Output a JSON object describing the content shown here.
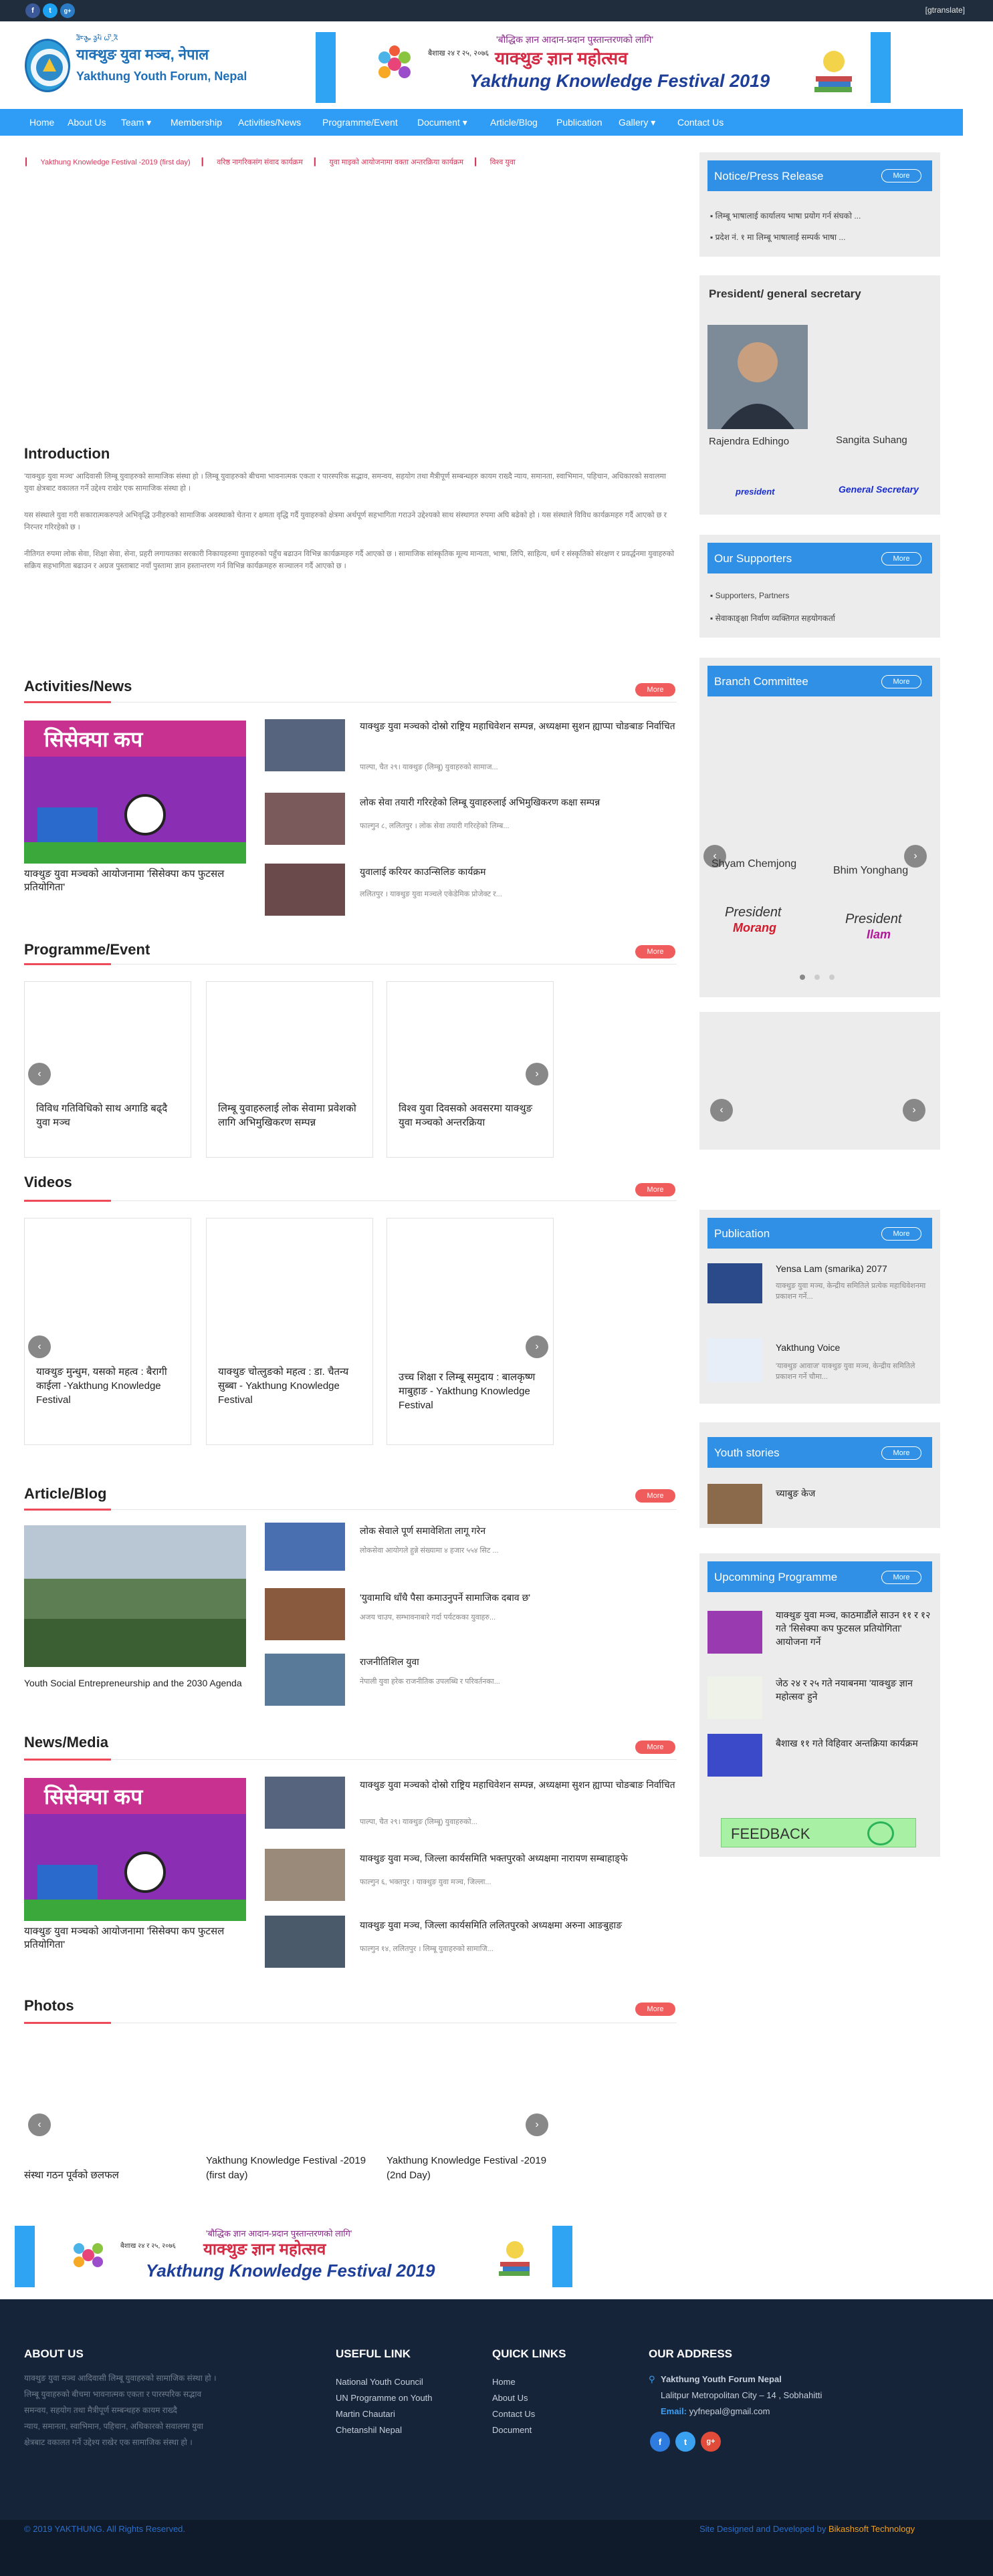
{
  "topbar": {
    "translate": "[gtranslate]",
    "social": [
      "f",
      "t",
      "g+"
    ]
  },
  "brand": {
    "nepali_name": "याक्थुङ युवा मञ्च, नेपाल",
    "english_name": "Yakthung Youth Forum, Nepal",
    "lipi_line": "ᤕᤠᤰᤌᤢᤱ ᤕᤢᤘᤠ ᤐᤡᤳᤖᤠ"
  },
  "banner": {
    "slogan": "'बौद्धिक ज्ञान आदान-प्रदान पुस्तान्तरणको लागि'",
    "festival_np": "याक्थुङ ज्ञान महोत्सव",
    "festival_en": "Yakthung Knowledge Festival 2019",
    "date": "बैशाख २४ र २५, २०७६"
  },
  "nav": {
    "items": [
      "Home",
      "About Us",
      "Team ▾",
      "Membership",
      "Activities/News",
      "Programme/Event",
      "Document ▾",
      "Article/Blog",
      "Publication",
      "Gallery ▾",
      "Contact Us"
    ]
  },
  "ticker": {
    "items": [
      "Yakthung Knowledge Festival -2019 (first day)",
      "वरिष्ठ नागरिकसंग संवाद कार्यक्रम",
      "युवा माइको आयोजनामा वक्ता अन्तरक्रिया कार्यक्रम",
      "विश्व युवा"
    ]
  },
  "intro": {
    "title": "Introduction",
    "paras": [
      "'याक्थुङ युवा मञ्च' आदिवासी लिम्बू युवाहरुको सामाजिक संस्था हो । लिम्बू युवाहरुको बीचमा भावनात्मक एकता र पारस्परिक सद्भाव, समन्वय, सहयोग तथा मैत्रीपूर्ण सम्बन्धहरु कायम राख्दै न्याय, समानता, स्वाभिमान, पहिचान, अधिकारको सवालमा युवा क्षेत्रबाट वकालत गर्ने उद्देश्य राखेर एक सामाजिक संस्था हो ।",
      "यस संस्थाले युवा गरी सकारात्मकरुपले अभिवृद्धि उनीहरुको सामाजिक अवस्थाको चेतना र क्षमता वृद्धि गर्दै युवाहरुको क्षेत्रमा अर्थपूर्ण सहभागिता गराउने उद्देश्यको साथ संस्थागत रुपमा अघि बढेको हो । यस संस्थाले विविध कार्यक्रमहरु गर्दै आएको छ र निरन्तर गरिरहेको छ ।",
      "नीतिगत रुपमा लोक सेवा, शिक्षा सेवा, सेना, प्रहरी लगायतका सरकारी निकायहरुमा युवाहरुको पहुँच बढाउन विभिन्न कार्यक्रमहरु गर्दै आएको छ । सामाजिक सांस्कृतिक मूल्य मान्यता, भाषा, लिपि, साहित्य, धर्म र संस्कृतिको संरक्षण र प्रवर्द्धनमा युवाहरुको सक्रिय सहभागिता बढाउन र अग्रज पुस्ताबाट नयाँ पुस्तामा ज्ञान हस्तान्तरण गर्न विभिन्न कार्यक्रमहरु सञ्चालन गर्दै आएको छ ।"
    ]
  },
  "activities": {
    "title": "Activities/News",
    "more": "More",
    "featured_img_title": "सिसेक्पा कप",
    "featured_caption": "याक्थुङ युवा मञ्चको आयोजनामा 'सिसेक्पा कप फुटसल प्रतियोगिता'",
    "items": [
      {
        "title": "याक्थुङ युवा मञ्चको दोस्रो राष्ट्रिय महाधिवेशन सम्पन्न, अध्यक्षमा सुशन ह्याप्पा चोङबाङ निर्वाचित",
        "meta": "पाल्पा, चैत २९। याक्थुङ (लिम्बू) युवाहरुको सामाज..."
      },
      {
        "title": "लोक सेवा तयारी गरिरहेको लिम्बू युवाहरुलाई अभिमुखिकरण कक्षा सम्पन्न",
        "meta": "फाल्गुन ८, ललितपुर । लोक सेवा तयारी गरिरहेको लिम्ब..."
      },
      {
        "title": "युवालाई करियर काउन्सिलिङ कार्यक्रम",
        "meta": "ललितपुर । याक्थुङ युवा मञ्चले एकेडेमिक प्रोजेक्ट र..."
      }
    ]
  },
  "programme": {
    "title": "Programme/Event",
    "more": "More",
    "items": [
      "विविध गतिविधिको साथ अगाडि बढ्दै युवा मञ्च",
      "लिम्बू युवाहरुलाई लोक सेवामा प्रवेशको लागि अभिमुखिकरण सम्पन्न",
      "विश्व युवा दिवसको अवसरमा याक्थुङ युवा मञ्चको अन्तरक्रिया"
    ]
  },
  "videos": {
    "title": "Videos",
    "more": "More",
    "items": [
      "याक्थुङ मुन्धुम, यसको महत्व : बैरागी काईला -Yakthung Knowledge Festival",
      "याक्थुङ चोत्लुङको महत्व : डा. चैतन्य सुब्बा - Yakthung Knowledge Festival",
      "उच्च शिक्षा र लिम्बू समुदाय : बालकृष्ण माबुहाङ - Yakthung Knowledge Festival"
    ]
  },
  "article": {
    "title": "Article/Blog",
    "more": "More",
    "featured_caption": "Youth Social Entrepreneurship and the 2030 Agenda",
    "items": [
      {
        "title": "लोक सेवाले पूर्ण समावेशिता लागू गरेन",
        "meta": "लोकसेवा आयोगले हुन्ने संख्यामा ४ हजार ५५४ सिट ..."
      },
      {
        "title": "'युवामाथि धाँधै पैसा कमाउनुपर्ने सामाजिक दबाव छ'",
        "meta": "अजय चाउप, सम्भावनाबारे गर्दा पर्यटकका युवाहरु..."
      },
      {
        "title": "राजनीतिशिल युवा",
        "meta": "नेपाली युवा हरेक राजनीतिक उपलब्धि र परिवर्तनका..."
      }
    ]
  },
  "newsmedia": {
    "title": "News/Media",
    "more": "More",
    "featured_img_title": "सिसेक्पा कप",
    "featured_caption": "याक्थुङ युवा मञ्चको आयोजनामा 'सिसेक्पा कप फुटसल प्रतियोगिता'",
    "items": [
      {
        "title": "याक्थुङ युवा मञ्चको दोस्रो राष्ट्रिय महाधिवेशन सम्पन्न, अध्यक्षमा सुशन ह्याप्पा चोङबाङ निर्वाचित",
        "meta": "पाल्पा, चैत २९। याक्थुङ (लिम्बू) युवाहरुको..."
      },
      {
        "title": "याक्थुङ युवा मञ्च, जिल्ला कार्यसमिति भक्तपुरको अध्यक्षमा नारायण सम्बाहाङ्फे",
        "meta": "फाल्गुन ६, भक्तपुर । याक्थुङ युवा मञ्च, जिल्ला..."
      },
      {
        "title": "याक्थुङ युवा मञ्च, जिल्ला कार्यसमिति ललितपुरको अध्यक्षमा अरुना आङबुहाङ",
        "meta": "फाल्गुन १४, ललितपुर । लिम्बू युवाहरुको सामाजि..."
      }
    ]
  },
  "photos": {
    "title": "Photos",
    "more": "More",
    "items": [
      "संस्था गठन पूर्वको छलफल",
      "Yakthung Knowledge Festival -2019 (first day)",
      "Yakthung Knowledge Festival -2019 (2nd Day)"
    ]
  },
  "sidebar": {
    "notice": {
      "title": "Notice/Press Release",
      "more": "More",
      "items": [
        "लिम्बू भाषालाई कार्यालय भाषा प्रयोग गर्न संघको ...",
        "प्रदेश नं. १ मा लिम्बू भाषालाई सम्पर्क भाषा ..."
      ]
    },
    "president": {
      "title": "President/ general secretary",
      "p1_name": "Rajendra Edhingo",
      "p2_name": "Sangita Suhang",
      "p1_role": "president",
      "p2_role": "General Secretary"
    },
    "supporters": {
      "title": "Our Supporters",
      "more": "More",
      "items": [
        "Supporters, Partners",
        "सेवाकाङ्क्षा निर्वाण व्यक्तिगत सहयोगकर्ता"
      ]
    },
    "branch": {
      "title": "Branch Committee",
      "more": "More",
      "b1_name": "Shyam Chemjong",
      "b2_name": "Bhim Yonghang",
      "b1_role": "President",
      "b1_place": "Morang",
      "b2_role": "President",
      "b2_place": "Ilam"
    },
    "publication": {
      "title": "Publication",
      "more": "More",
      "items": [
        {
          "title": "Yensa Lam (smarika) 2077",
          "meta": "याक्थुङ युवा मञ्च, केन्द्रीय समितिले प्रत्येक महाधिवेशनमा प्रकाशन गर्ने..."
        },
        {
          "title": "Yakthung Voice",
          "meta": "'याक्थुङ आवाज' याक्थुङ युवा मञ्च, केन्द्रीय समितिले प्रकाशन गर्ने चौमा..."
        }
      ]
    },
    "stories": {
      "title": "Youth stories",
      "more": "More",
      "items": [
        "च्याबुङ केज"
      ]
    },
    "upcoming": {
      "title": "Upcomming Programme",
      "more": "More",
      "items": [
        "याक्थुङ युवा मञ्च, काठमाडौंले साउन ११ र १२ गते 'सिसेक्पा कप फुटसल प्रतियोगिता' आयोजना गर्ने",
        "जेठ २४ र २५ गते नयाबनमा 'याक्थुङ ज्ञान महोत्सव' हुने",
        "बैशाख ११ गते विहिवार अन्तक्रिया कार्यक्रम"
      ]
    },
    "feedback": "FEEDBACK"
  },
  "footer": {
    "about_title": "ABOUT US",
    "about_text": [
      "याक्थुङ युवा मञ्च आदिवासी लिम्बू युवाहरुको सामाजिक संस्था हो ।",
      "लिम्बू युवाहरुको बीचमा भावनात्मक एकता र पारस्परिक सद्भाव",
      "समन्वय, सहयोग तथा मैत्रीपूर्ण सम्बन्धहरु कायम राख्दै",
      "न्याय, समानता, स्वाभिमान, पहिचान, अधिकारको सवालमा युवा",
      "क्षेत्रबाट वकालत गर्ने उद्देश्य राखेर एक सामाजिक संस्था हो ।"
    ],
    "useful_title": "USEFUL LINK",
    "useful": [
      "National Youth Council",
      "UN Programme on Youth",
      "Martin Chautari",
      "Chetanshil Nepal"
    ],
    "quick_title": "QUICK LINKS",
    "quick": [
      "Home",
      "About Us",
      "Contact Us",
      "Document"
    ],
    "address_title": "OUR ADDRESS",
    "org": "Yakthung Youth Forum Nepal",
    "address": "Lalitpur Metropolitan City – 14 , Sobhahitti",
    "email_label": "Email:",
    "email": "yyfnepal@gmail.com",
    "copyright": "© 2019 YAKTHUNG. All Rights Reserved.",
    "credit_prefix": "Site Designed and Developed by",
    "credit_name": "Bikashsoft Technology"
  }
}
